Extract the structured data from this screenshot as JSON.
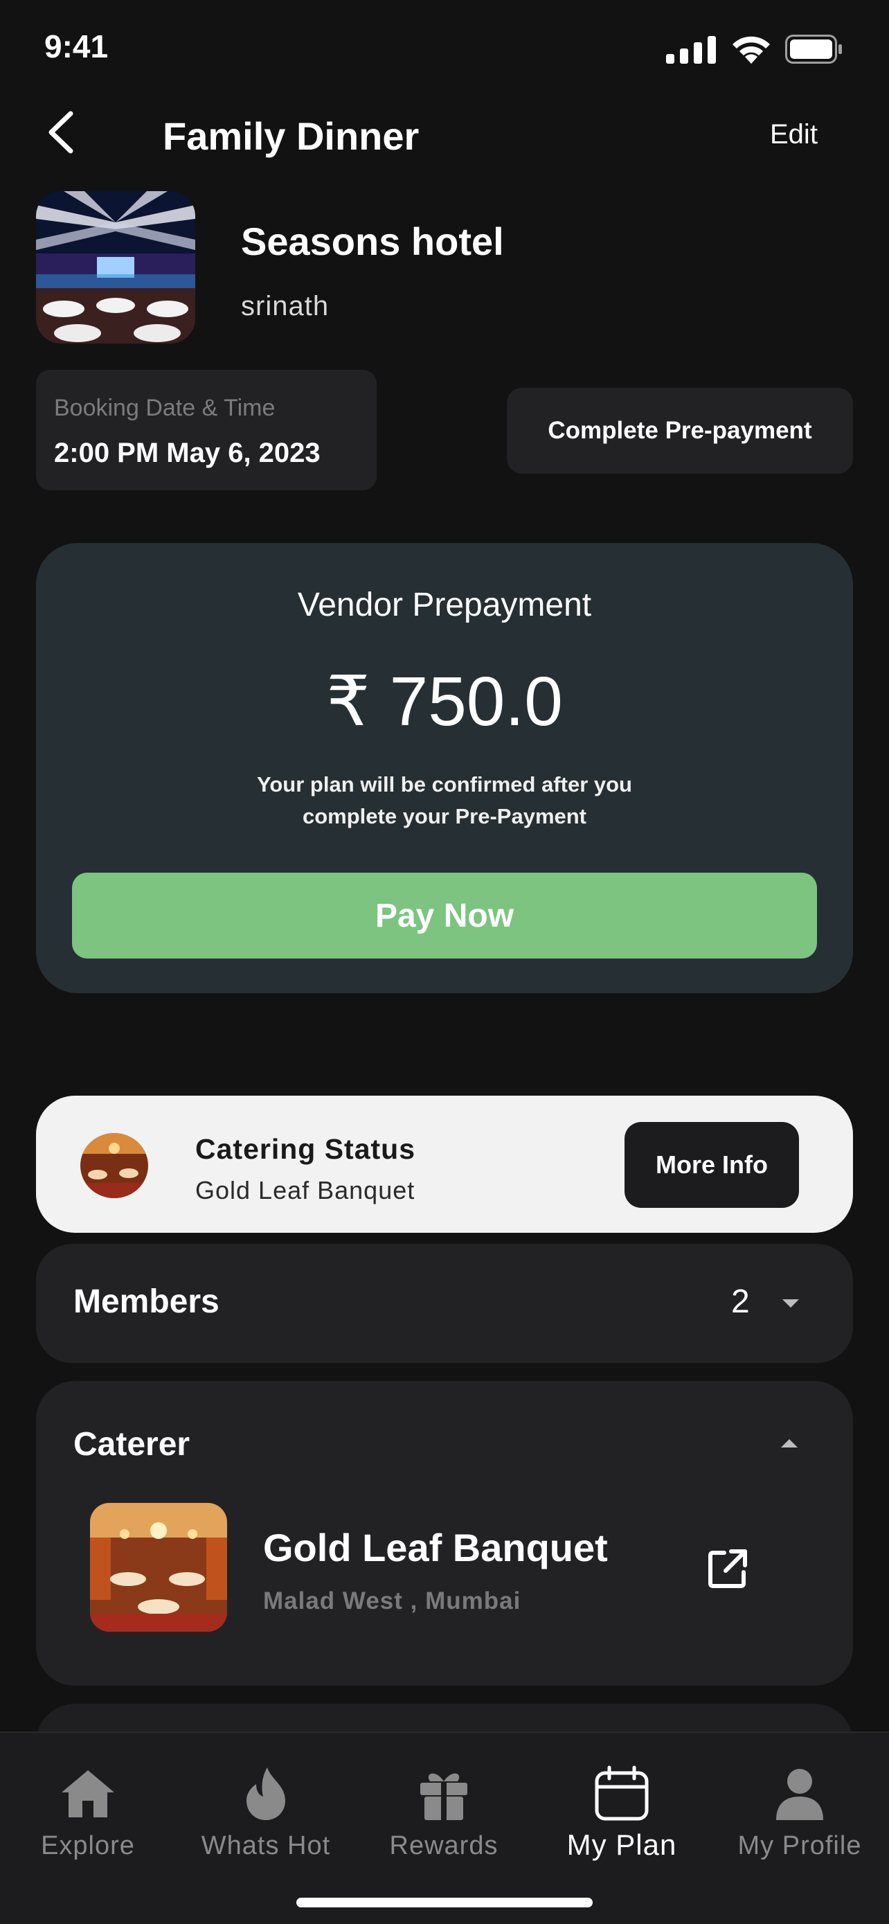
{
  "status_bar": {
    "time": "9:41"
  },
  "header": {
    "title": "Family Dinner",
    "edit_label": "Edit"
  },
  "venue": {
    "name": "Seasons hotel",
    "owner": "srinath"
  },
  "booking": {
    "label": "Booking Date & Time",
    "value": "2:00 PM May 6, 2023"
  },
  "prepayment_button": {
    "label": "Complete Pre-payment"
  },
  "vendor_prepayment": {
    "title": "Vendor Prepayment",
    "amount": "₹ 750.0",
    "note_line1": "Your plan will be confirmed after you",
    "note_line2": "complete your Pre-Payment",
    "pay_label": "Pay Now"
  },
  "catering_status": {
    "title": "Catering Status",
    "subtitle": "Gold Leaf Banquet",
    "more_label": "More Info"
  },
  "members": {
    "label": "Members",
    "count": "2"
  },
  "caterer": {
    "label": "Caterer",
    "name": "Gold Leaf Banquet",
    "location": "Malad West , Mumbai"
  },
  "tabs": [
    {
      "label": "Explore",
      "icon": "home-icon",
      "active": false
    },
    {
      "label": "Whats Hot",
      "icon": "flame-icon",
      "active": false
    },
    {
      "label": "Rewards",
      "icon": "gift-icon",
      "active": false
    },
    {
      "label": "My Plan",
      "icon": "calendar-icon",
      "active": true
    },
    {
      "label": "My Profile",
      "icon": "profile-icon",
      "active": false
    }
  ],
  "colors": {
    "pay_button": "#7cc47f",
    "vendor_card": "#262f34",
    "background": "#121212"
  }
}
